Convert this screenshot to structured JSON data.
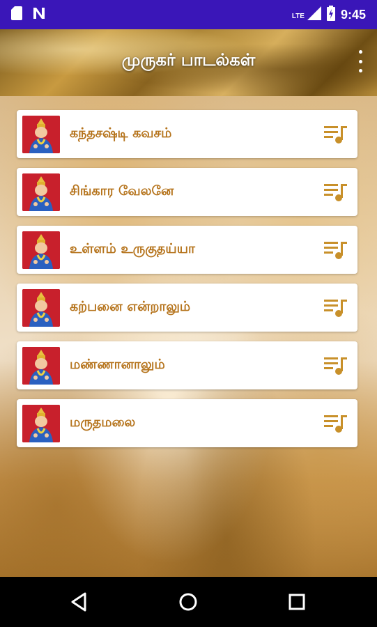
{
  "status_bar": {
    "network_label": "LTE",
    "time": "9:45",
    "icons": [
      "sd-card-icon",
      "n-notification-icon",
      "signal-icon",
      "battery-charging-icon"
    ]
  },
  "app_bar": {
    "title": "முருகர் பாடல்கள்",
    "overflow_icon": "more-vert-icon"
  },
  "songs": [
    {
      "title": "கந்தசஷ்டி கவசம்",
      "icon": "playlist-music-icon"
    },
    {
      "title": "சிங்கார வேலனே",
      "icon": "playlist-music-icon"
    },
    {
      "title": "உள்ளம் உருகுதய்யா",
      "icon": "playlist-music-icon"
    },
    {
      "title": "கற்பனை என்றாலும்",
      "icon": "playlist-music-icon"
    },
    {
      "title": "மண்ணானாலும்",
      "icon": "playlist-music-icon"
    },
    {
      "title": "மருதமலை",
      "icon": "playlist-music-icon"
    }
  ],
  "colors": {
    "status_bar": "#3a16b8",
    "song_title": "#b5731b",
    "card": "#ffffff"
  },
  "nav_bar": {
    "buttons": [
      "back-icon",
      "home-icon",
      "recents-icon"
    ]
  }
}
